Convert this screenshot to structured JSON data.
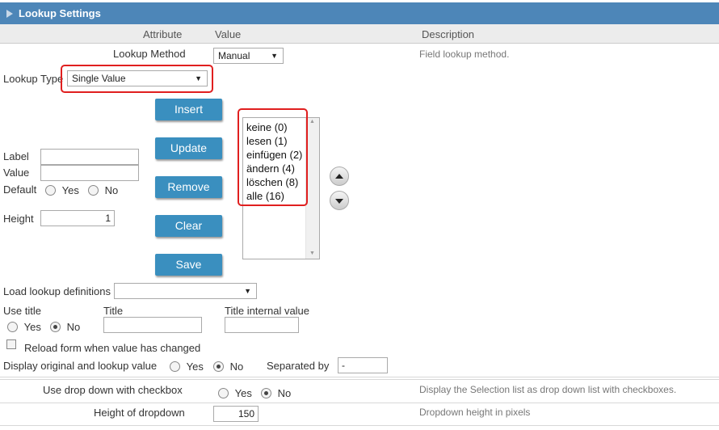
{
  "header": {
    "title": "Lookup Settings"
  },
  "columns": {
    "attribute": "Attribute",
    "value": "Value",
    "description": "Description"
  },
  "lookup_method": {
    "label": "Lookup Method",
    "value": "Manual",
    "description": "Field lookup method."
  },
  "lookup_type": {
    "label": "Lookup Type",
    "value": "Single Value"
  },
  "buttons": {
    "insert": "Insert",
    "update": "Update",
    "remove": "Remove",
    "clear": "Clear",
    "save": "Save"
  },
  "fields": {
    "label_label": "Label",
    "value_label": "Value",
    "default_label": "Default",
    "yes": "Yes",
    "no": "No",
    "height_label": "Height",
    "height_value": "1"
  },
  "lookup_values": [
    "keine (0)",
    "lesen (1)",
    "einfügen (2)",
    "ändern (4)",
    "löschen (8)",
    "alle (16)"
  ],
  "load_definitions": {
    "label": "Load lookup definitions",
    "value": ""
  },
  "use_title": {
    "label": "Use title",
    "yes": "Yes",
    "no": "No",
    "title_label": "Title",
    "internal_label": "Title internal value"
  },
  "reload_form": {
    "label": "Reload form when value has changed"
  },
  "display_original": {
    "label": "Display original and lookup value",
    "yes": "Yes",
    "no": "No",
    "separated_label": "Separated by",
    "separated_value": "-"
  },
  "use_dropdown": {
    "label": "Use drop down with checkbox",
    "yes": "Yes",
    "no": "No",
    "description": "Display the Selection list as drop down list with checkboxes."
  },
  "dropdown_height": {
    "label": "Height of dropdown",
    "value": "150",
    "description": "Dropdown height in pixels"
  }
}
